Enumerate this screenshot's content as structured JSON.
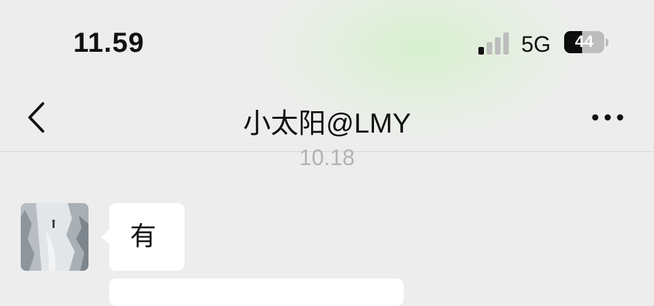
{
  "status_bar": {
    "time": "11.59",
    "network": "5G",
    "battery_level": "44",
    "battery_fraction": 0.44
  },
  "header": {
    "title": "小太阳@LMY",
    "back_icon": "chevron-left-icon",
    "more_icon": "ellipsis-icon"
  },
  "chat": {
    "timestamp": "10.18",
    "messages": [
      {
        "sender": "contact",
        "text": "有"
      },
      {
        "sender": "contact",
        "text": ""
      }
    ]
  },
  "colors": {
    "background": "#ededed",
    "bubble": "#ffffff",
    "timestamp": "#b3b3b3",
    "text": "#111111"
  }
}
